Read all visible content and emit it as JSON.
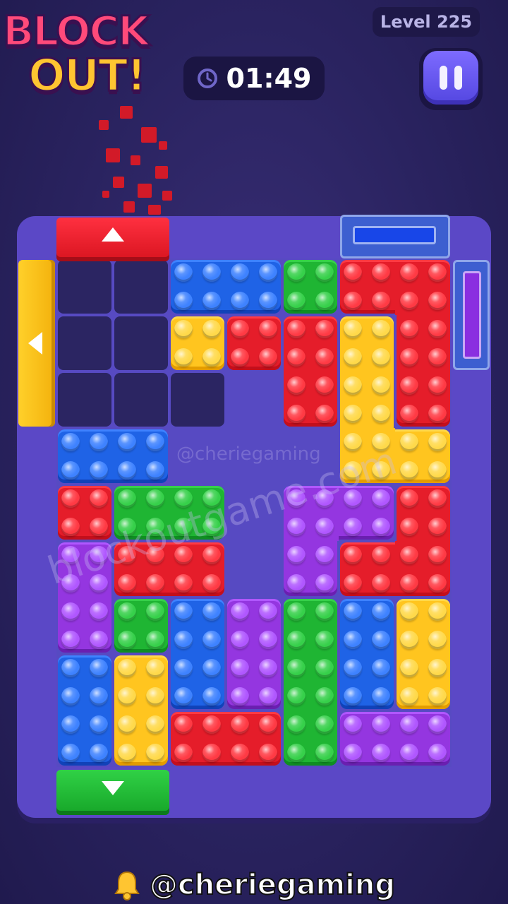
{
  "logo": {
    "line1": "BLOCK",
    "line2": "OUT!"
  },
  "level_label": "Level 225",
  "timer": {
    "value": "01:49",
    "icon": "clock-icon"
  },
  "pause": {
    "icon": "pause-icon"
  },
  "watermark": {
    "main": "blockoutgame.com",
    "small": "@cheriegaming"
  },
  "footer": {
    "handle": "@cheriegaming",
    "icon": "bell-icon"
  },
  "colors": {
    "red": "#e51d2a",
    "blue": "#1f63e6",
    "green": "#1fb533",
    "yellow": "#ffc51f",
    "purple": "#9436e0",
    "board": "#5b48c6",
    "background": "#2a2360"
  },
  "board": {
    "cols": 7,
    "rows": 9,
    "empty_cells": [
      [
        0,
        0
      ],
      [
        1,
        0
      ],
      [
        0,
        1
      ],
      [
        1,
        1
      ],
      [
        0,
        2
      ],
      [
        1,
        2
      ],
      [
        2,
        2
      ]
    ],
    "pieces": [
      {
        "color": "blue",
        "cells": [
          [
            2,
            0
          ],
          [
            3,
            0
          ]
        ]
      },
      {
        "color": "green",
        "cells": [
          [
            4,
            0
          ]
        ]
      },
      {
        "color": "red",
        "cells": [
          [
            5,
            0
          ],
          [
            6,
            0
          ],
          [
            6,
            1
          ],
          [
            6,
            2
          ]
        ]
      },
      {
        "color": "yellow",
        "cells": [
          [
            2,
            1
          ]
        ]
      },
      {
        "color": "red",
        "cells": [
          [
            3,
            1
          ]
        ]
      },
      {
        "color": "red",
        "cells": [
          [
            4,
            1
          ],
          [
            4,
            2
          ]
        ]
      },
      {
        "color": "yellow",
        "cells": [
          [
            5,
            1
          ],
          [
            5,
            2
          ],
          [
            5,
            3
          ],
          [
            6,
            3
          ]
        ]
      },
      {
        "color": "blue",
        "cells": [
          [
            0,
            3
          ],
          [
            1,
            3
          ]
        ]
      },
      {
        "color": "red",
        "cells": [
          [
            0,
            4
          ]
        ]
      },
      {
        "color": "green",
        "cells": [
          [
            1,
            4
          ],
          [
            2,
            4
          ]
        ]
      },
      {
        "color": "purple",
        "cells": [
          [
            4,
            4
          ],
          [
            5,
            4
          ],
          [
            4,
            5
          ]
        ]
      },
      {
        "color": "red",
        "cells": [
          [
            6,
            4
          ],
          [
            6,
            5
          ],
          [
            5,
            5
          ]
        ]
      },
      {
        "color": "purple",
        "cells": [
          [
            0,
            5
          ],
          [
            0,
            6
          ]
        ]
      },
      {
        "color": "red",
        "cells": [
          [
            1,
            5
          ],
          [
            2,
            5
          ]
        ]
      },
      {
        "color": "green",
        "cells": [
          [
            1,
            6
          ]
        ]
      },
      {
        "color": "blue",
        "cells": [
          [
            2,
            6
          ],
          [
            2,
            7
          ]
        ]
      },
      {
        "color": "purple",
        "cells": [
          [
            3,
            6
          ],
          [
            3,
            7
          ]
        ]
      },
      {
        "color": "green",
        "cells": [
          [
            4,
            6
          ],
          [
            4,
            7
          ],
          [
            4,
            8
          ]
        ]
      },
      {
        "color": "blue",
        "cells": [
          [
            5,
            6
          ],
          [
            5,
            7
          ]
        ]
      },
      {
        "color": "yellow",
        "cells": [
          [
            6,
            6
          ],
          [
            6,
            7
          ]
        ]
      },
      {
        "color": "blue",
        "cells": [
          [
            0,
            7
          ],
          [
            0,
            8
          ]
        ]
      },
      {
        "color": "yellow",
        "cells": [
          [
            1,
            7
          ],
          [
            1,
            8
          ]
        ]
      },
      {
        "color": "red",
        "cells": [
          [
            2,
            8
          ],
          [
            3,
            8
          ]
        ]
      },
      {
        "color": "purple",
        "cells": [
          [
            5,
            8
          ],
          [
            6,
            8
          ]
        ]
      }
    ]
  },
  "gates": [
    {
      "name": "red-exit-gate",
      "color": "red",
      "direction": "up"
    },
    {
      "name": "yellow-exit-gate",
      "color": "yellow",
      "direction": "left"
    },
    {
      "name": "green-exit-gate",
      "color": "green",
      "direction": "down"
    },
    {
      "name": "blue-exit-gate",
      "color": "blue",
      "direction": "up"
    },
    {
      "name": "purple-exit-gate",
      "color": "purple",
      "direction": "right"
    }
  ]
}
